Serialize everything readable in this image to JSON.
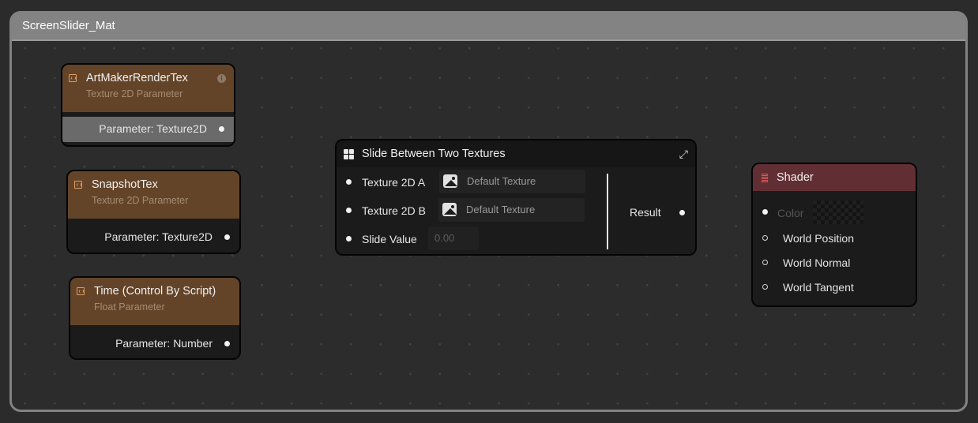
{
  "group": {
    "title": "ScreenSlider_Mat"
  },
  "nodes": {
    "art_maker": {
      "title": "ArtMakerRenderTex",
      "subtitle": "Texture 2D Parameter",
      "output_label": "Parameter: Texture2D",
      "info_icon": "i",
      "highlighted": true
    },
    "snapshot": {
      "title": "SnapshotTex",
      "subtitle": "Texture 2D Parameter",
      "output_label": "Parameter: Texture2D"
    },
    "time": {
      "title": "Time (Control By Script)",
      "subtitle": "Float Parameter",
      "output_label": "Parameter: Number"
    },
    "slide": {
      "title": "Slide Between Two Textures",
      "expand_icon": "⤢",
      "inputs": [
        {
          "label": "Texture 2D A",
          "value": "Default Texture"
        },
        {
          "label": "Texture 2D B",
          "value": "Default Texture"
        },
        {
          "label": "Slide Value",
          "value": "0.00"
        }
      ],
      "output_label": "Result"
    },
    "shader": {
      "title": "Shader",
      "inputs": [
        {
          "label": "Color",
          "connected": false,
          "disabled": true
        },
        {
          "label": "World Position"
        },
        {
          "label": "World Normal"
        },
        {
          "label": "World Tangent"
        }
      ]
    }
  },
  "colors": {
    "parameter_header": "#644429",
    "shader_header": "#612f33",
    "group_frame": "#828282",
    "canvas": "#2b2b2b"
  }
}
